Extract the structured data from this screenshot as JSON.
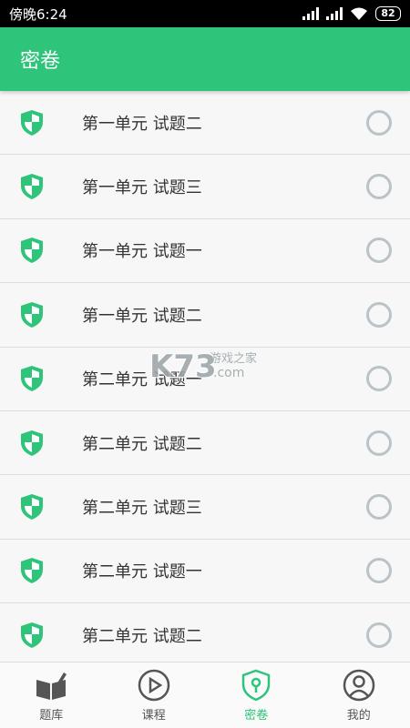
{
  "status_bar": {
    "time": "傍晚6:24",
    "battery": "82"
  },
  "app_bar": {
    "title": "密卷"
  },
  "list": {
    "items": [
      {
        "label": "第一单元 试题二"
      },
      {
        "label": "第一单元 试题三"
      },
      {
        "label": "第一单元 试题一"
      },
      {
        "label": "第一单元 试题二"
      },
      {
        "label": "第二单元 试题一"
      },
      {
        "label": "第二单元 试题二"
      },
      {
        "label": "第二单元 试题三"
      },
      {
        "label": "第二单元 试题一"
      },
      {
        "label": "第二单元 试题二"
      }
    ]
  },
  "watermark": {
    "text": "K73",
    "subtext": "游戏之家",
    "domain": ".com"
  },
  "bottom_nav": {
    "items": [
      {
        "label": "题库",
        "icon": "book-icon"
      },
      {
        "label": "课程",
        "icon": "play-icon"
      },
      {
        "label": "密卷",
        "icon": "shield-lock-icon"
      },
      {
        "label": "我的",
        "icon": "user-icon"
      }
    ],
    "active": "密卷"
  },
  "colors": {
    "accent": "#2ec47a",
    "radio": "#b9c3c8"
  }
}
